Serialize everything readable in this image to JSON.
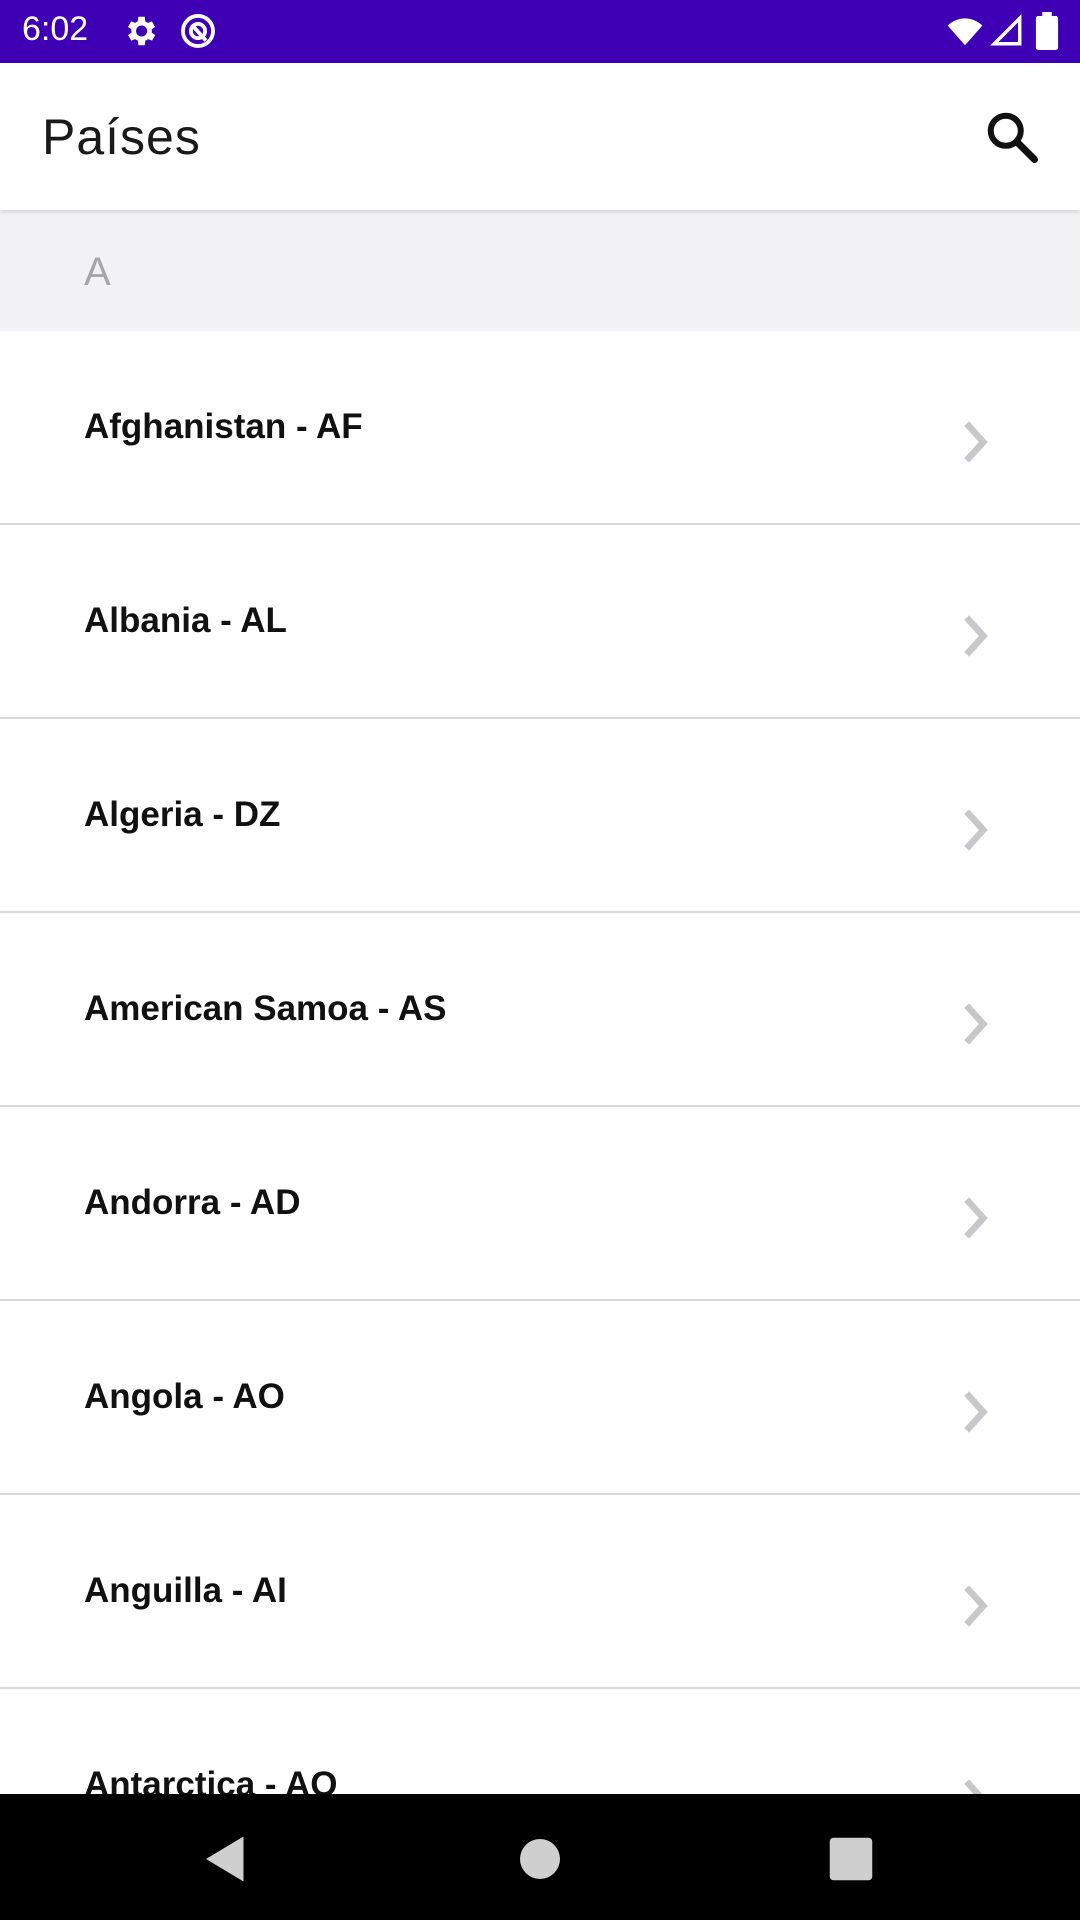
{
  "status_bar": {
    "time": "6:02",
    "background": "#3f00b5",
    "icons": [
      "settings-icon",
      "vpn-icon",
      "wifi-icon",
      "signal-icon",
      "battery-icon"
    ]
  },
  "app_bar": {
    "title": "Países",
    "search_icon": "search-icon"
  },
  "section": {
    "letter": "A"
  },
  "countries": [
    "Afghanistan - AF",
    "Albania - AL",
    "Algeria - DZ",
    "American Samoa - AS",
    "Andorra - AD",
    "Angola - AO",
    "Anguilla - AI",
    "Antarctica - AQ"
  ],
  "nav_bar": {
    "buttons": [
      "back-icon",
      "home-icon",
      "recents-icon"
    ]
  }
}
